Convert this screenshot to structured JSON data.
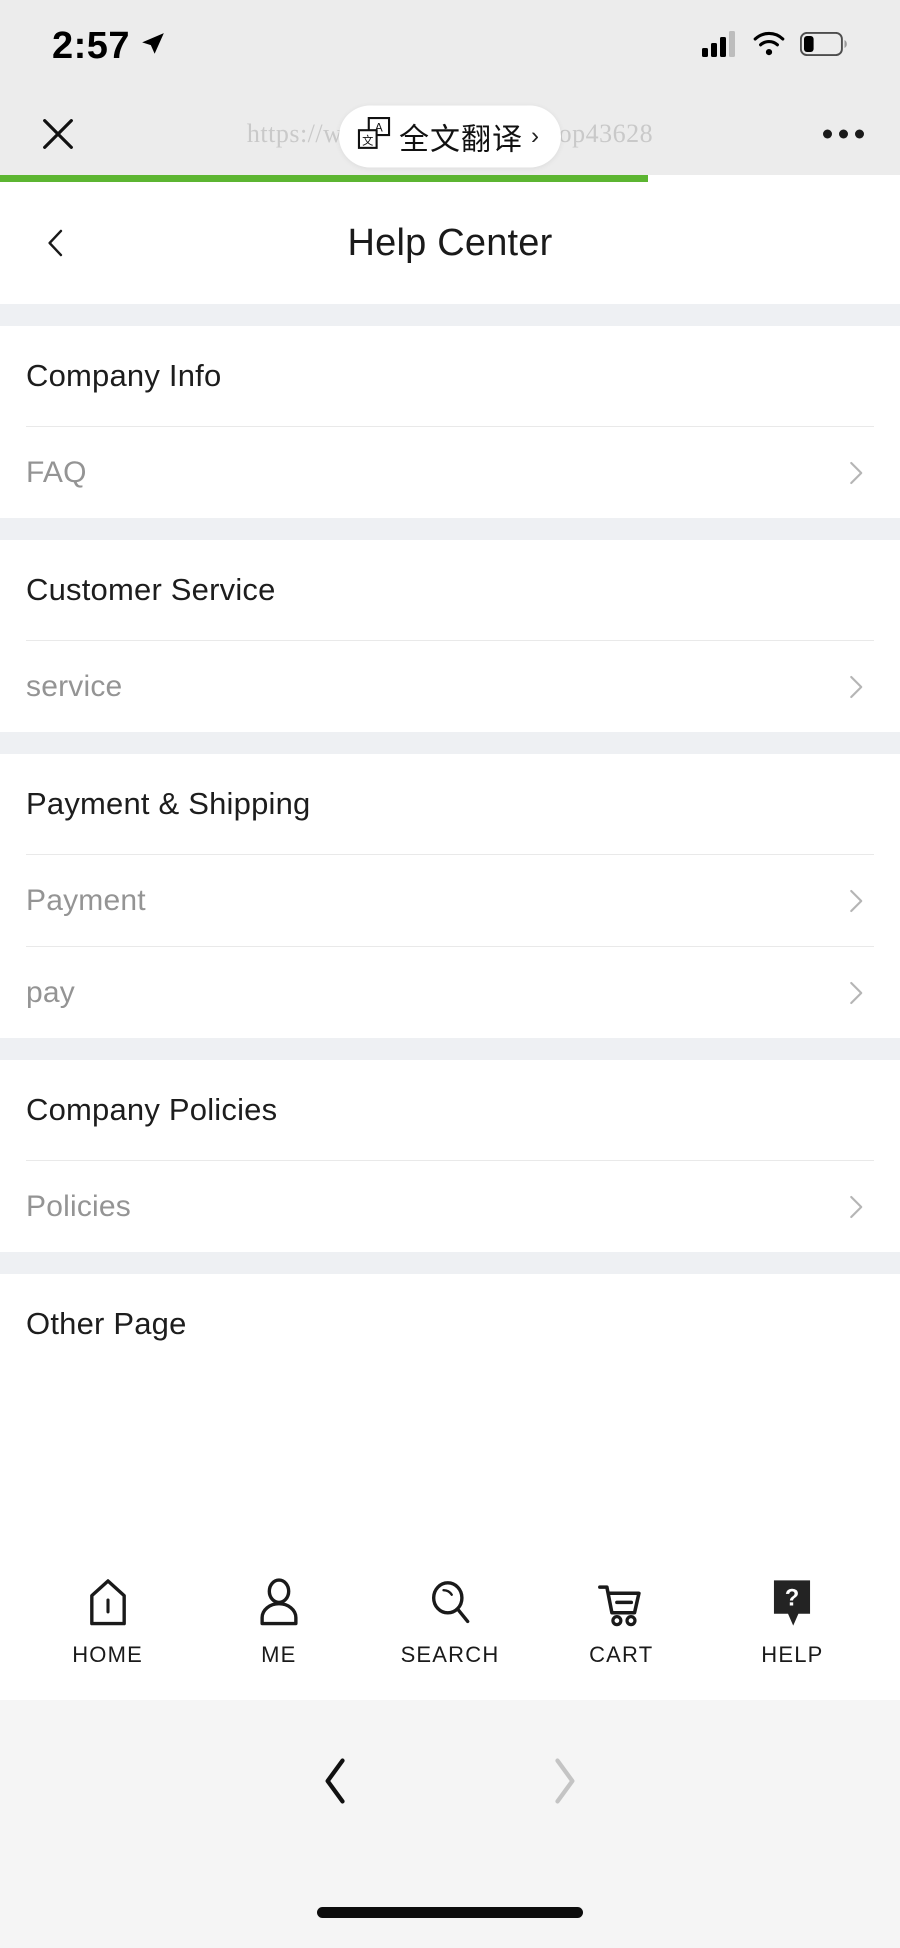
{
  "status_bar": {
    "time": "2:57",
    "location_icon": "location-arrow-icon",
    "signal_icon": "cellular-signal-icon",
    "signal_bars_filled": 3,
    "signal_bars_total": 4,
    "wifi_icon": "wifi-icon",
    "battery_icon": "battery-icon",
    "battery_level_percent": 25
  },
  "browser_header": {
    "close_label": "close-icon",
    "url": "https://www.htzkam.com/ishop43628",
    "more_label": "more-options-icon",
    "translate": {
      "icon": "translate-icon",
      "label": "全文翻译",
      "chevron": "›"
    }
  },
  "progress": {
    "percent": 72,
    "color": "#5cb531"
  },
  "page": {
    "navbar": {
      "back_icon": "chevron-left-icon",
      "title": "Help Center"
    },
    "sections": [
      {
        "heading": "Company Info",
        "rows": [
          {
            "label": "FAQ",
            "chevron": "chevron-right-icon"
          }
        ]
      },
      {
        "heading": "Customer Service",
        "rows": [
          {
            "label": "service",
            "chevron": "chevron-right-icon"
          }
        ]
      },
      {
        "heading": "Payment & Shipping",
        "rows": [
          {
            "label": "Payment",
            "chevron": "chevron-right-icon"
          },
          {
            "label": "pay",
            "chevron": "chevron-right-icon"
          }
        ]
      },
      {
        "heading": "Company Policies",
        "rows": [
          {
            "label": "Policies",
            "chevron": "chevron-right-icon"
          }
        ]
      },
      {
        "heading": "Other Page",
        "rows": []
      }
    ]
  },
  "tabbar": {
    "items": [
      {
        "label": "HOME",
        "icon": "home-icon"
      },
      {
        "label": "ME",
        "icon": "person-icon"
      },
      {
        "label": "SEARCH",
        "icon": "search-icon"
      },
      {
        "label": "CART",
        "icon": "shopping-cart-icon"
      },
      {
        "label": "HELP",
        "icon": "help-bubble-icon"
      }
    ]
  },
  "browser_bottom": {
    "back_icon": "chevron-left-icon",
    "forward_icon": "chevron-right-icon",
    "back_enabled": true,
    "forward_enabled": false
  },
  "colors": {
    "accent_green": "#5cb531",
    "page_bg": "#ffffff",
    "chrome_bg": "#ececec",
    "section_gap": "#eef0f3",
    "row_label": "#949494",
    "heading": "#1d1d1d"
  }
}
